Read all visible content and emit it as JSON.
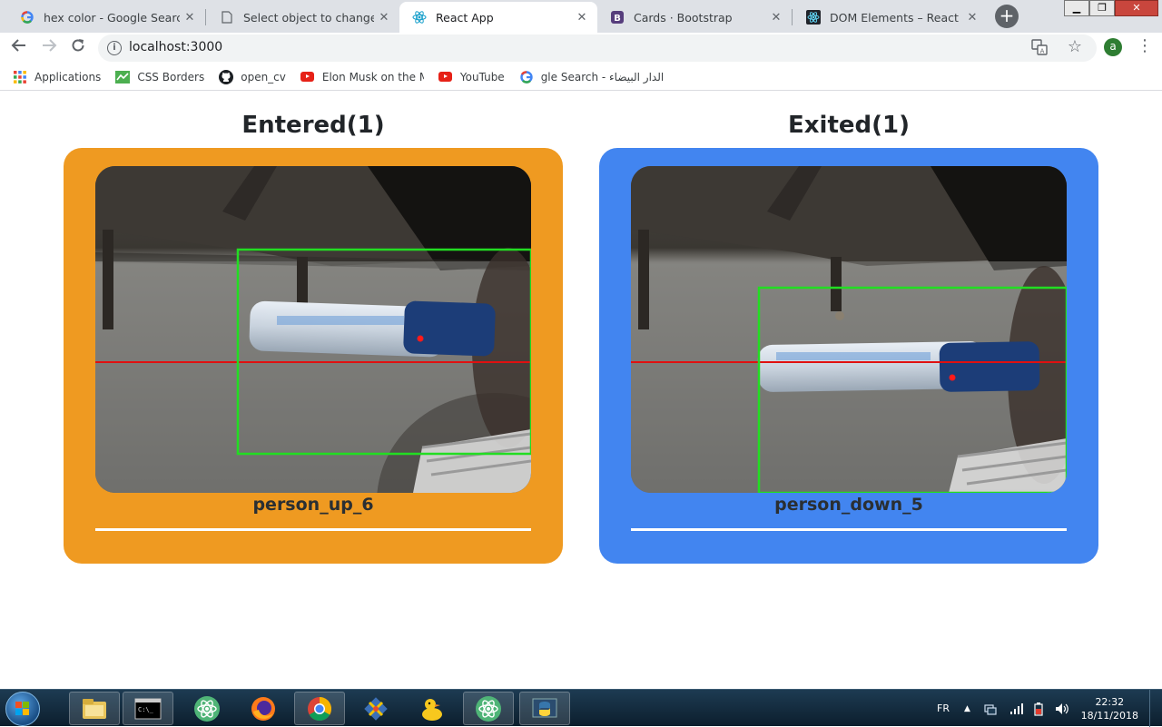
{
  "browser": {
    "tabs": [
      {
        "title": "hex color - Google Search",
        "icon": "google-icon",
        "active": false
      },
      {
        "title": "Select object to change | Dja",
        "icon": "page-icon",
        "active": false
      },
      {
        "title": "React App",
        "icon": "react-icon",
        "active": true
      },
      {
        "title": "Cards · Bootstrap",
        "icon": "bootstrap-icon",
        "active": false
      },
      {
        "title": "DOM Elements – React",
        "icon": "react-icon",
        "active": false
      }
    ],
    "close_glyph": "✕",
    "new_tab_glyph": "+",
    "url": "localhost:3000",
    "profile_initial": "a"
  },
  "bookmarks": [
    {
      "label": "Applications",
      "icon": "apps-grid-icon"
    },
    {
      "label": "CSS Borders",
      "icon": "css-borders-icon"
    },
    {
      "label": "open_cv",
      "icon": "github-icon"
    },
    {
      "label": "Elon Musk on the Me",
      "icon": "youtube-icon"
    },
    {
      "label": "YouTube",
      "icon": "youtube-icon"
    },
    {
      "label": "gle Search - الدار البيضاء",
      "icon": "google-icon"
    }
  ],
  "page": {
    "entered": {
      "heading": "Entered(1)",
      "caption": "person_up_6",
      "color": "#ef9a21"
    },
    "exited": {
      "heading": "Exited(1)",
      "caption": "person_down_5",
      "color": "#4285f0"
    }
  },
  "taskbar": {
    "language": "FR",
    "time": "22:32",
    "date": "18/11/2018",
    "apps": [
      "windows-explorer-icon",
      "command-prompt-icon",
      "atom-icon",
      "firefox-icon",
      "chrome-icon",
      "git-icon",
      "duck-icon",
      "atom-icon",
      "python-icon"
    ]
  },
  "colors": {
    "detection_box": "#22dd22",
    "counting_line": "#e01010",
    "centroid": "#ff1a1a"
  }
}
